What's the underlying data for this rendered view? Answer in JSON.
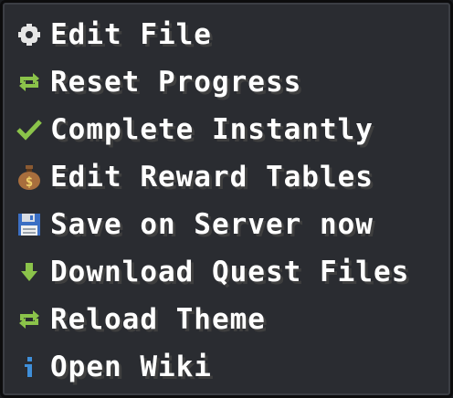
{
  "menu": {
    "items": [
      {
        "label": "Edit File",
        "icon": "gear-icon"
      },
      {
        "label": "Reset Progress",
        "icon": "reset-arrows-icon"
      },
      {
        "label": "Complete Instantly",
        "icon": "checkmark-icon"
      },
      {
        "label": "Edit Reward Tables",
        "icon": "money-bag-icon"
      },
      {
        "label": "Save on Server now",
        "icon": "floppy-disk-icon"
      },
      {
        "label": "Download Quest Files",
        "icon": "download-arrow-icon"
      },
      {
        "label": "Reload Theme",
        "icon": "reload-arrows-icon"
      },
      {
        "label": "Open Wiki",
        "icon": "info-icon"
      }
    ]
  },
  "colors": {
    "text": "#ffffff",
    "background": "#2a2c31",
    "border": "#0c0c0d",
    "accent_green": "#8bc34a",
    "info_blue": "#3f8fd9"
  }
}
